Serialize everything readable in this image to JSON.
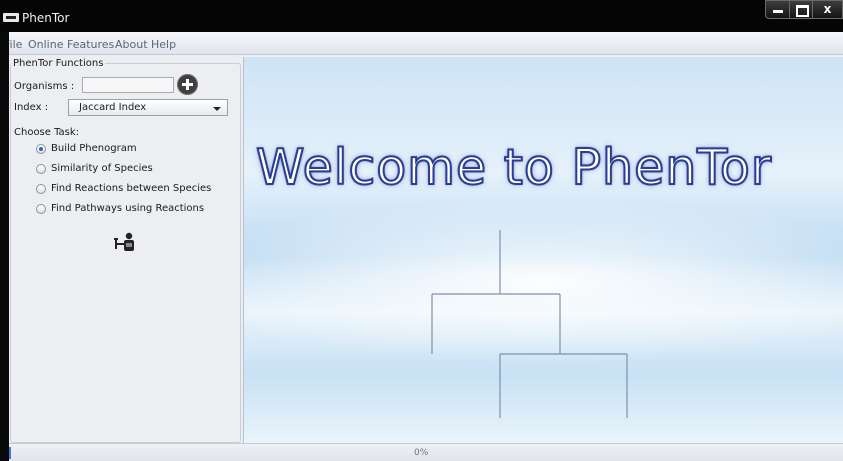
{
  "window": {
    "title": "PhenTor"
  },
  "menu": [
    {
      "label": "File"
    },
    {
      "label": "Online Features"
    },
    {
      "label": "About"
    },
    {
      "label": "Help"
    }
  ],
  "panel": {
    "title": "PhenTor Functions",
    "organisms_label": "Organisms :",
    "organisms_value": "",
    "index_label": "Index :",
    "index_value": "Jaccard Index",
    "choose_task_label": "Choose Task:",
    "tasks": [
      {
        "label": "Build Phenogram",
        "selected": true
      },
      {
        "label": "Similarity of Species",
        "selected": false
      },
      {
        "label": "Find Reactions between Species",
        "selected": false
      },
      {
        "label": "Find Pathways using Reactions",
        "selected": false
      }
    ],
    "run_icon": "person-with-tool-icon",
    "add_icon": "plus-circle-icon"
  },
  "welcome": {
    "title": "Welcome to PhenTor"
  },
  "status": {
    "progress_text": "0%",
    "progress": 0
  },
  "colors": {
    "accent": "#2a3d8f",
    "titlebar": "#050505",
    "panel_bg": "#eceef2"
  }
}
